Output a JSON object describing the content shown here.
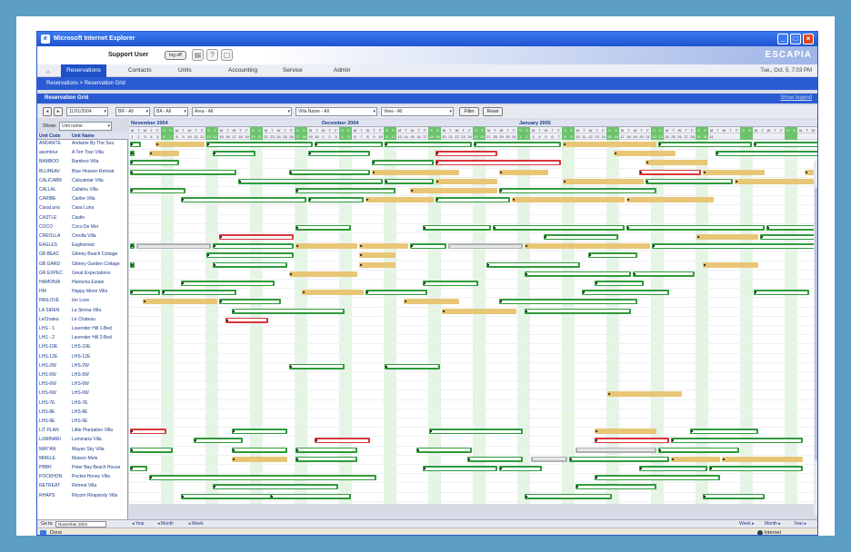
{
  "window": {
    "title": "Microsoft Internet Explorer",
    "brand": "ESCAPIA",
    "controls": {
      "minimize": "_",
      "maximize": "□",
      "close": "×"
    }
  },
  "userbar": {
    "user": "Support User",
    "logout": "log off",
    "tool_icons": [
      "printer-icon",
      "help-icon",
      "window-icon"
    ]
  },
  "nav": {
    "tabs": [
      "Reservations",
      "Contacts",
      "Units",
      "Accounting",
      "Service",
      "Admin"
    ],
    "active": "Reservations",
    "date": "Tue., Oct. 5, 7:03 PM"
  },
  "breadcrumb": "Reservations > Reservation Grid",
  "panel": {
    "title": "Reservation Grid",
    "legend_link": "Show legend"
  },
  "filters": {
    "date": "11/01/2004",
    "br": "BR - All",
    "ba": "BA - All",
    "area": "Area - All",
    "villa": "Villa Name - All",
    "view": "View - All",
    "filter_btn": "Filter",
    "reset_btn": "Reset"
  },
  "show": {
    "label": "Show:",
    "value": "Unit name"
  },
  "columns": {
    "code": "Unit Code",
    "name": "Unit Name"
  },
  "units": [
    {
      "code": "ANDANTE",
      "name": "Andante By The Sea"
    },
    {
      "code": "asvmtour",
      "name": "A Terr Tour Villa"
    },
    {
      "code": "BAMBOO",
      "name": "Bamboo Villa"
    },
    {
      "code": "BLUHEAV",
      "name": "Blue Heaven Retreat"
    },
    {
      "code": "CALICABR",
      "name": "Calicabriar Villa"
    },
    {
      "code": "CALLAL",
      "name": "Callalou Villa"
    },
    {
      "code": "CARIBE",
      "name": "Caribe Villa"
    },
    {
      "code": "CasaLuna",
      "name": "Casa Luna"
    },
    {
      "code": "CASTLE",
      "name": "Castle"
    },
    {
      "code": "COCO",
      "name": "Coco De Mer"
    },
    {
      "code": "CREOLLA",
      "name": "Creolla Villa"
    },
    {
      "code": "EAGLES",
      "name": "Eaglesnest"
    },
    {
      "code": "GB BEAC",
      "name": "Gibney Beach Cottage"
    },
    {
      "code": "GB GARD",
      "name": "Gibney Garden Cottage"
    },
    {
      "code": "GR EXPEC",
      "name": "Great Expectations"
    },
    {
      "code": "HAMONIA",
      "name": "Hamonia Estate"
    },
    {
      "code": "HM",
      "name": "Happy Moon Villa"
    },
    {
      "code": "INNLOVE",
      "name": "Inn Love"
    },
    {
      "code": "LA SIREN",
      "name": "La Sirena Villa"
    },
    {
      "code": "LeChatea",
      "name": "Le Chateau"
    },
    {
      "code": "LHS - 1",
      "name": "Lavender Hill 1-Bed"
    },
    {
      "code": "LHS - 2",
      "name": "Lavender Hill 2-Bed"
    },
    {
      "code": "LHS-10E",
      "name": "LHS-10E"
    },
    {
      "code": "LHS-12E",
      "name": "LHS-12E"
    },
    {
      "code": "LHS-2W",
      "name": "LHS-2W"
    },
    {
      "code": "LHS-5W",
      "name": "LHS-5W"
    },
    {
      "code": "LHS-6W",
      "name": "LHS-6W"
    },
    {
      "code": "LHS-6W",
      "name": "LHS-6W"
    },
    {
      "code": "LHS-7E",
      "name": "LHS-7E"
    },
    {
      "code": "LHS-8E",
      "name": "LHS-8E"
    },
    {
      "code": "LHS-9E",
      "name": "LHS-9E"
    },
    {
      "code": "LIT PLAN",
      "name": "Little Plantation Villa"
    },
    {
      "code": "LUMINARI",
      "name": "Luminaria Villa"
    },
    {
      "code": "MAY'AN",
      "name": "Mayan Sky Villa"
    },
    {
      "code": "MMELE",
      "name": "Maison Mele"
    },
    {
      "code": "PBBH",
      "name": "Peter Bay Beach House"
    },
    {
      "code": "POCKHON",
      "name": "Pocket Honey Villa"
    },
    {
      "code": "RETREAT",
      "name": "Retreat Villa"
    },
    {
      "code": "RHAPS",
      "name": "Rhyzm Rhapsody Villa"
    }
  ],
  "months": [
    {
      "label": "November 2004",
      "start": 0
    },
    {
      "label": "December 2004",
      "start": 30
    },
    {
      "label": "January 2005",
      "start": 61
    }
  ],
  "dow_letters": [
    "M",
    "T",
    "W",
    "T",
    "F",
    "S",
    "S"
  ],
  "day_count": 110,
  "bookings": [
    [
      {
        "s": 0,
        "len": 2,
        "t": "g"
      },
      {
        "s": 4,
        "len": 8,
        "t": "y"
      },
      {
        "s": 12,
        "len": 17,
        "t": "g"
      },
      {
        "s": 29,
        "len": 11,
        "t": "g"
      },
      {
        "s": 40,
        "len": 14,
        "t": "g"
      },
      {
        "s": 54,
        "len": 14,
        "t": "g"
      },
      {
        "s": 68,
        "len": 15,
        "t": "y"
      },
      {
        "s": 83,
        "len": 15,
        "t": "g"
      },
      {
        "s": 98,
        "len": 12,
        "t": "g"
      }
    ],
    [
      {
        "s": 0,
        "len": 1,
        "t": "g"
      },
      {
        "s": 3,
        "len": 5,
        "t": "y"
      },
      {
        "s": 13,
        "len": 7,
        "t": "g"
      },
      {
        "s": 28,
        "len": 10,
        "t": "g"
      },
      {
        "s": 48,
        "len": 10,
        "t": "r"
      },
      {
        "s": 76,
        "len": 10,
        "t": "y"
      },
      {
        "s": 92,
        "len": 18,
        "t": "g"
      }
    ],
    [
      {
        "s": 0,
        "len": 8,
        "t": "g"
      },
      {
        "s": 38,
        "len": 10,
        "t": "g"
      },
      {
        "s": 48,
        "len": 20,
        "t": "r"
      },
      {
        "s": 81,
        "len": 10,
        "t": "y"
      }
    ],
    [
      {
        "s": 0,
        "len": 17,
        "t": "g"
      },
      {
        "s": 25,
        "len": 13,
        "t": "g"
      },
      {
        "s": 38,
        "len": 14,
        "t": "y"
      },
      {
        "s": 58,
        "len": 8,
        "t": "y"
      },
      {
        "s": 80,
        "len": 10,
        "t": "r"
      },
      {
        "s": 90,
        "len": 10,
        "t": "y"
      },
      {
        "s": 106,
        "len": 4,
        "t": "y"
      }
    ],
    [
      {
        "s": 17,
        "len": 23,
        "t": "g"
      },
      {
        "s": 40,
        "len": 8,
        "t": "g"
      },
      {
        "s": 48,
        "len": 10,
        "t": "y"
      },
      {
        "s": 68,
        "len": 13,
        "t": "y"
      },
      {
        "s": 81,
        "len": 14,
        "t": "g"
      },
      {
        "s": 95,
        "len": 13,
        "t": "y"
      }
    ],
    [
      {
        "s": 0,
        "len": 9,
        "t": "g"
      },
      {
        "s": 26,
        "len": 16,
        "t": "g"
      },
      {
        "s": 44,
        "len": 14,
        "t": "y"
      },
      {
        "s": 58,
        "len": 25,
        "t": "g"
      }
    ],
    [
      {
        "s": 8,
        "len": 20,
        "t": "g"
      },
      {
        "s": 28,
        "len": 9,
        "t": "g"
      },
      {
        "s": 37,
        "len": 11,
        "t": "y"
      },
      {
        "s": 48,
        "len": 12,
        "t": "g"
      },
      {
        "s": 60,
        "len": 18,
        "t": "y"
      },
      {
        "s": 78,
        "len": 14,
        "t": "y"
      }
    ],
    [],
    [],
    [
      {
        "s": 26,
        "len": 9,
        "t": "g"
      },
      {
        "s": 46,
        "len": 11,
        "t": "g"
      },
      {
        "s": 57,
        "len": 21,
        "t": "g"
      },
      {
        "s": 78,
        "len": 22,
        "t": "g"
      },
      {
        "s": 100,
        "len": 10,
        "t": "g"
      }
    ],
    [
      {
        "s": 14,
        "len": 12,
        "t": "r"
      },
      {
        "s": 65,
        "len": 12,
        "t": "g"
      },
      {
        "s": 89,
        "len": 10,
        "t": "y"
      },
      {
        "s": 99,
        "len": 11,
        "t": "g"
      }
    ],
    [
      {
        "s": 0,
        "len": 1,
        "t": "g"
      },
      {
        "s": 1,
        "len": 12,
        "t": "s"
      },
      {
        "s": 13,
        "len": 13,
        "t": "g"
      },
      {
        "s": 26,
        "len": 10,
        "t": "y"
      },
      {
        "s": 36,
        "len": 8,
        "t": "y"
      },
      {
        "s": 44,
        "len": 6,
        "t": "g"
      },
      {
        "s": 50,
        "len": 12,
        "t": "s"
      },
      {
        "s": 62,
        "len": 20,
        "t": "y"
      },
      {
        "s": 82,
        "len": 28,
        "t": "g"
      }
    ],
    [
      {
        "s": 12,
        "len": 14,
        "t": "g"
      },
      {
        "s": 36,
        "len": 6,
        "t": "y"
      },
      {
        "s": 72,
        "len": 8,
        "t": "g"
      }
    ],
    [
      {
        "s": 0,
        "len": 1,
        "t": "g"
      },
      {
        "s": 13,
        "len": 12,
        "t": "g"
      },
      {
        "s": 36,
        "len": 6,
        "t": "y"
      },
      {
        "s": 56,
        "len": 15,
        "t": "g"
      },
      {
        "s": 90,
        "len": 9,
        "t": "y"
      }
    ],
    [
      {
        "s": 25,
        "len": 11,
        "t": "y"
      },
      {
        "s": 62,
        "len": 17,
        "t": "g"
      },
      {
        "s": 79,
        "len": 10,
        "t": "g"
      }
    ],
    [
      {
        "s": 8,
        "len": 15,
        "t": "g"
      },
      {
        "s": 46,
        "len": 9,
        "t": "g"
      },
      {
        "s": 73,
        "len": 8,
        "t": "g"
      }
    ],
    [
      {
        "s": 0,
        "len": 5,
        "t": "g"
      },
      {
        "s": 5,
        "len": 12,
        "t": "g"
      },
      {
        "s": 27,
        "len": 10,
        "t": "y"
      },
      {
        "s": 37,
        "len": 10,
        "t": "g"
      },
      {
        "s": 71,
        "len": 14,
        "t": "g"
      },
      {
        "s": 98,
        "len": 9,
        "t": "g"
      }
    ],
    [
      {
        "s": 2,
        "len": 12,
        "t": "y"
      },
      {
        "s": 14,
        "len": 10,
        "t": "g"
      },
      {
        "s": 43,
        "len": 9,
        "t": "y"
      },
      {
        "s": 58,
        "len": 22,
        "t": "g"
      }
    ],
    [
      {
        "s": 16,
        "len": 18,
        "t": "g"
      },
      {
        "s": 49,
        "len": 12,
        "t": "y"
      },
      {
        "s": 62,
        "len": 17,
        "t": "g"
      }
    ],
    [
      {
        "s": 15,
        "len": 7,
        "t": "r"
      }
    ],
    [],
    [],
    [],
    [],
    [
      {
        "s": 25,
        "len": 9,
        "t": "g"
      },
      {
        "s": 40,
        "len": 9,
        "t": "g"
      }
    ],
    [],
    [],
    [
      {
        "s": 75,
        "len": 12,
        "t": "y"
      }
    ],
    [],
    [],
    [],
    [
      {
        "s": 0,
        "len": 6,
        "t": "r"
      },
      {
        "s": 16,
        "len": 9,
        "t": "g"
      },
      {
        "s": 47,
        "len": 15,
        "t": "g"
      },
      {
        "s": 73,
        "len": 10,
        "t": "y"
      },
      {
        "s": 88,
        "len": 11,
        "t": "g"
      }
    ],
    [
      {
        "s": 10,
        "len": 8,
        "t": "g"
      },
      {
        "s": 29,
        "len": 9,
        "t": "r"
      },
      {
        "s": 73,
        "len": 12,
        "t": "r"
      },
      {
        "s": 85,
        "len": 21,
        "t": "g"
      }
    ],
    [
      {
        "s": 0,
        "len": 7,
        "t": "g"
      },
      {
        "s": 16,
        "len": 9,
        "t": "g"
      },
      {
        "s": 26,
        "len": 10,
        "t": "g"
      },
      {
        "s": 45,
        "len": 9,
        "t": "g"
      },
      {
        "s": 70,
        "len": 13,
        "t": "s"
      },
      {
        "s": 83,
        "len": 13,
        "t": "g"
      }
    ],
    [
      {
        "s": 16,
        "len": 9,
        "t": "y"
      },
      {
        "s": 26,
        "len": 10,
        "t": "g"
      },
      {
        "s": 53,
        "len": 9,
        "t": "g"
      },
      {
        "s": 63,
        "len": 6,
        "t": "s"
      },
      {
        "s": 69,
        "len": 16,
        "t": "g"
      },
      {
        "s": 85,
        "len": 8,
        "t": "y"
      },
      {
        "s": 93,
        "len": 13,
        "t": "y"
      }
    ],
    [
      {
        "s": 0,
        "len": 3,
        "t": "g"
      },
      {
        "s": 46,
        "len": 12,
        "t": "g"
      },
      {
        "s": 58,
        "len": 7,
        "t": "g"
      },
      {
        "s": 80,
        "len": 11,
        "t": "g"
      },
      {
        "s": 91,
        "len": 15,
        "t": "g"
      }
    ],
    [
      {
        "s": 3,
        "len": 36,
        "t": "g"
      },
      {
        "s": 73,
        "len": 20,
        "t": "g"
      }
    ],
    [
      {
        "s": 13,
        "len": 20,
        "t": "g"
      },
      {
        "s": 70,
        "len": 13,
        "t": "g"
      }
    ],
    [
      {
        "s": 8,
        "len": 15,
        "t": "g"
      },
      {
        "s": 22,
        "len": 13,
        "t": "g"
      },
      {
        "s": 62,
        "len": 14,
        "t": "g"
      },
      {
        "s": 90,
        "len": 10,
        "t": "g"
      }
    ]
  ],
  "bottom": {
    "goto_label": "Go to:",
    "goto_value": "November 2004",
    "prev_links": [
      "◂ Year",
      "◂ Month",
      "◂ Week"
    ],
    "next_links": [
      "Week ▸",
      "Month ▸",
      "Year ▸"
    ]
  },
  "status": {
    "left": "Done",
    "right": "Internet"
  },
  "colors": {
    "booked": "#2f9a3b",
    "conflict": "#d8343a",
    "hold": "#e8c676",
    "blocked": "#aeb0b4",
    "weekend": "#6cc36c"
  }
}
